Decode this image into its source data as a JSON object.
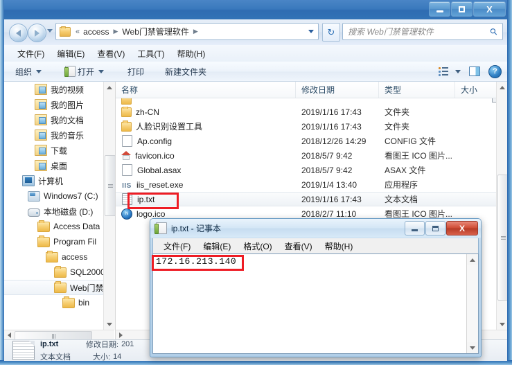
{
  "explorer": {
    "caption": {
      "minimize_label": "最小化",
      "maximize_label": "最大化",
      "close_label": "X"
    },
    "address": {
      "back_label": "后退",
      "forward_label": "前进",
      "double_chevron": "«",
      "crumbs": [
        "access",
        "Web门禁管理软件"
      ],
      "separator": "▶",
      "refresh_label": "↻"
    },
    "search": {
      "placeholder": "搜索 Web门禁管理软件",
      "icon": "search-icon"
    },
    "menubar": [
      "文件(F)",
      "编辑(E)",
      "查看(V)",
      "工具(T)",
      "帮助(H)"
    ],
    "toolbar": {
      "organize_label": "组织",
      "open_label": "打开",
      "print_label": "打印",
      "new_folder_label": "新建文件夹",
      "help_glyph": "?"
    },
    "nav_tree": [
      {
        "label": "我的视频",
        "indent": 3,
        "icon": "library-video-icon"
      },
      {
        "label": "我的图片",
        "indent": 3,
        "icon": "library-pictures-icon"
      },
      {
        "label": "我的文档",
        "indent": 3,
        "icon": "library-documents-icon"
      },
      {
        "label": "我的音乐",
        "indent": 3,
        "icon": "library-music-icon"
      },
      {
        "label": "下载",
        "indent": 3,
        "icon": "downloads-icon"
      },
      {
        "label": "桌面",
        "indent": 3,
        "icon": "desktop-icon"
      },
      {
        "label": "计算机",
        "indent": 1,
        "icon": "computer-icon"
      },
      {
        "label": "Windows7 (C:)",
        "indent": 2,
        "icon": "drive-c-icon"
      },
      {
        "label": "本地磁盘 (D:)",
        "indent": 2,
        "icon": "drive-icon"
      },
      {
        "label": "Access Data",
        "indent": 3,
        "icon": "folder-icon"
      },
      {
        "label": "Program Fil",
        "indent": 3,
        "icon": "folder-icon"
      },
      {
        "label": "access",
        "indent": 4,
        "icon": "folder-icon"
      },
      {
        "label": "SQL2000",
        "indent": 5,
        "icon": "folder-icon"
      },
      {
        "label": "Web门禁",
        "indent": 5,
        "icon": "folder-icon",
        "selected": true
      },
      {
        "label": "bin",
        "indent": 6,
        "icon": "folder-icon"
      }
    ],
    "columns": {
      "name": "名称",
      "date": "修改日期",
      "type": "类型",
      "size": "大小"
    },
    "files": [
      {
        "name": "zh-CN",
        "date": "2019/1/16 17:43",
        "type": "文件夹",
        "size": "",
        "icon": "folder-icon"
      },
      {
        "name": "人脸识别设置工具",
        "date": "2019/1/16 17:43",
        "type": "文件夹",
        "size": "",
        "icon": "folder-icon"
      },
      {
        "name": "Ap.config",
        "date": "2018/12/26 14:29",
        "type": "CONFIG 文件",
        "size": "",
        "icon": "file-icon"
      },
      {
        "name": "favicon.ico",
        "date": "2018/5/7 9:42",
        "type": "看图王 ICO 图片...",
        "size": "",
        "icon": "ico-house-icon"
      },
      {
        "name": "Global.asax",
        "date": "2018/5/7 9:42",
        "type": "ASAX 文件",
        "size": "",
        "icon": "file-icon"
      },
      {
        "name": "iis_reset.exe",
        "date": "2019/1/4 13:40",
        "type": "应用程序",
        "size": "",
        "icon": "iis-icon"
      },
      {
        "name": "ip.txt",
        "date": "2019/1/16 17:43",
        "type": "文本文档",
        "size": "",
        "icon": "text-file-icon",
        "highlighted": true
      },
      {
        "name": "logo.ico",
        "date": "2018/2/7 11:10",
        "type": "看图王 ICO 图片...",
        "size": "",
        "icon": "ico-globe-icon"
      }
    ],
    "details": {
      "file_name": "ip.txt",
      "file_type": "文本文档",
      "date_label": "修改日期:",
      "date_value": "201",
      "size_label": "大小:",
      "size_value": "14"
    }
  },
  "notepad": {
    "title": "ip.txt - 记事本",
    "menubar": [
      "文件(F)",
      "编辑(E)",
      "格式(O)",
      "查看(V)",
      "帮助(H)"
    ],
    "content": "172.16.213.140",
    "caption": {
      "minimize_label": "最小化",
      "maximize_label": "最大化",
      "close_label": "X"
    }
  },
  "annotations": {
    "accent_color": "#ee1c24",
    "boxes": [
      "ip-txt-row-highlight",
      "ip-address-text-highlight"
    ]
  }
}
